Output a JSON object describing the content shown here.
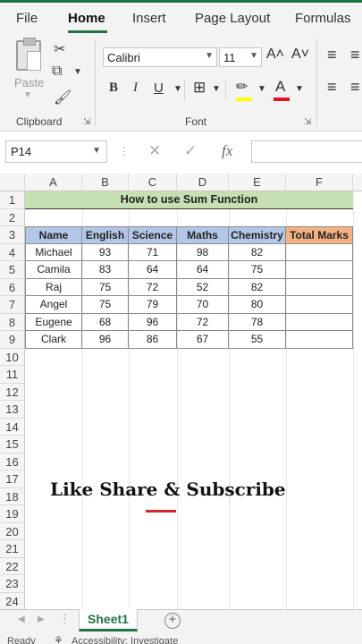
{
  "menu_tabs": [
    "File",
    "Home",
    "Insert",
    "Page Layout",
    "Formulas"
  ],
  "active_tab": "Home",
  "ribbon": {
    "paste_label": "Paste",
    "clipboard_label": "Clipboard",
    "font_label": "Font",
    "font_name": "Calibri",
    "font_size": "11",
    "grow_font": "A˄",
    "shrink_font": "A˅",
    "bold": "B",
    "italic": "I",
    "underline": "U",
    "highlight_color": "#ffff00",
    "font_color": "#e81123"
  },
  "formula_bar": {
    "name_box": "P14",
    "fx": "fx",
    "value": ""
  },
  "columns": [
    "A",
    "B",
    "C",
    "D",
    "E",
    "F"
  ],
  "rows": [
    "1",
    "2",
    "3",
    "4",
    "5",
    "6",
    "7",
    "8",
    "9",
    "10",
    "11",
    "12",
    "13",
    "14",
    "15",
    "16",
    "17",
    "18",
    "19",
    "20",
    "21",
    "22",
    "23",
    "24"
  ],
  "sheet": {
    "title": "How to use Sum Function",
    "headers": [
      "Name",
      "English",
      "Science",
      "Maths",
      "Chemistry",
      "Total Marks"
    ],
    "data": [
      [
        "Michael",
        "93",
        "71",
        "98",
        "82",
        ""
      ],
      [
        "Camila",
        "83",
        "64",
        "64",
        "75",
        ""
      ],
      [
        "Raj",
        "75",
        "72",
        "52",
        "82",
        ""
      ],
      [
        "Angel",
        "75",
        "79",
        "70",
        "80",
        ""
      ],
      [
        "Eugene",
        "68",
        "96",
        "72",
        "78",
        ""
      ],
      [
        "Clark",
        "96",
        "86",
        "67",
        "55",
        ""
      ]
    ]
  },
  "overlay_text": "Like Share & Subscribe",
  "sheet_tabs": [
    "Sheet1"
  ],
  "status": {
    "ready": "Ready",
    "accessibility": "Accessibility: Investigate"
  },
  "colors": {
    "excel_green": "#217346",
    "title_fill": "#c6e0b4",
    "header_fill": "#b4c6e7",
    "total_fill": "#f4b183",
    "accent_red": "#d8232a"
  }
}
